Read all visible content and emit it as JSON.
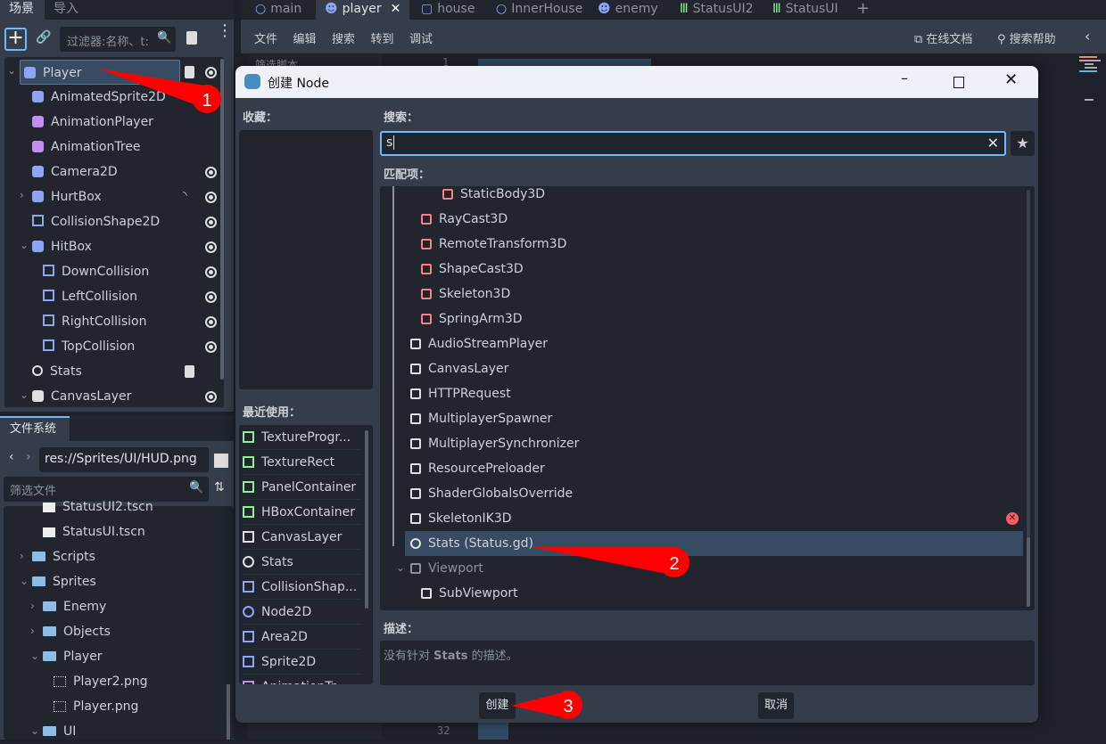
{
  "left_dock": {
    "tabs": [
      "场景",
      "导入"
    ],
    "filter_placeholder": "过滤器:名称、t:",
    "scene_tree": [
      {
        "label": "Player",
        "icon": "character-body-icon",
        "selected": true,
        "script": true,
        "visible": true
      },
      {
        "label": "AnimatedSprite2D",
        "icon": "animated-sprite-icon"
      },
      {
        "label": "AnimationPlayer",
        "icon": "animation-player-icon"
      },
      {
        "label": "AnimationTree",
        "icon": "animation-tree-icon"
      },
      {
        "label": "Camera2D",
        "icon": "camera-icon",
        "visible": true
      },
      {
        "label": "HurtBox",
        "icon": "area2d-icon",
        "signal": true,
        "visible": true
      },
      {
        "label": "CollisionShape2D",
        "icon": "collision-shape-icon",
        "visible": true
      },
      {
        "label": "HitBox",
        "icon": "area2d-icon",
        "visible": true
      },
      {
        "label": "DownCollision",
        "icon": "collision-shape-icon",
        "visible": true
      },
      {
        "label": "LeftCollision",
        "icon": "collision-shape-icon",
        "visible": true
      },
      {
        "label": "RightCollision",
        "icon": "collision-shape-icon",
        "visible": true
      },
      {
        "label": "TopCollision",
        "icon": "collision-shape-icon",
        "visible": true
      },
      {
        "label": "Stats",
        "icon": "node-icon",
        "script": true
      },
      {
        "label": "CanvasLayer",
        "icon": "canvas-layer-icon",
        "visible": true
      }
    ],
    "filesystem": {
      "tab": "文件系统",
      "path": "res://Sprites/UI/HUD.png",
      "filter_placeholder": "筛选文件",
      "items": [
        {
          "label": "StatusUI2.tscn",
          "type": "scene"
        },
        {
          "label": "StatusUI.tscn",
          "type": "scene"
        },
        {
          "label": "Scripts",
          "type": "folder"
        },
        {
          "label": "Sprites",
          "type": "folder"
        },
        {
          "label": "Enemy",
          "type": "folder"
        },
        {
          "label": "Objects",
          "type": "folder"
        },
        {
          "label": "Player",
          "type": "folder"
        },
        {
          "label": "Player2.png",
          "type": "image"
        },
        {
          "label": "Player.png",
          "type": "image"
        },
        {
          "label": "UI",
          "type": "folder"
        }
      ]
    }
  },
  "editor": {
    "tabs": [
      "main",
      "player",
      "house",
      "InnerHouse",
      "enemy",
      "StatusUI2",
      "StatusUI"
    ],
    "active_tab": "player",
    "menu": [
      "文件",
      "编辑",
      "搜索",
      "转到",
      "调试"
    ],
    "online_docs": "在线文档",
    "search_help": "搜索帮助",
    "script_filter": "筛选脚本",
    "line_numbers": [
      "1",
      "32"
    ]
  },
  "dialog": {
    "title": "创建 Node",
    "favorites_label": "收藏：",
    "recent_label": "最近使用：",
    "recent": [
      {
        "label": "TextureProgr...",
        "color": "#8eef97"
      },
      {
        "label": "TextureRect",
        "color": "#8eef97"
      },
      {
        "label": "PanelContainer",
        "color": "#8eef97"
      },
      {
        "label": "HBoxContainer",
        "color": "#8eef97"
      },
      {
        "label": "CanvasLayer",
        "color": "#e0e0e0"
      },
      {
        "label": "Stats",
        "color": "#e0e0e0"
      },
      {
        "label": "CollisionShap...",
        "color": "#8da5f3"
      },
      {
        "label": "Node2D",
        "color": "#8da5f3"
      },
      {
        "label": "Area2D",
        "color": "#8da5f3"
      },
      {
        "label": "Sprite2D",
        "color": "#8da5f3"
      },
      {
        "label": "AnimationTr...",
        "color": "#c38ef1"
      }
    ],
    "search_label": "搜索：",
    "search_value": "s",
    "matches_label": "匹配项：",
    "matches": [
      {
        "label": "StaticBody3D",
        "color": "#fc7f7f"
      },
      {
        "label": "RayCast3D",
        "color": "#fc7f7f"
      },
      {
        "label": "RemoteTransform3D",
        "color": "#fc7f7f"
      },
      {
        "label": "ShapeCast3D",
        "color": "#fc7f7f"
      },
      {
        "label": "Skeleton3D",
        "color": "#fc7f7f"
      },
      {
        "label": "SpringArm3D",
        "color": "#fc7f7f"
      },
      {
        "label": "AudioStreamPlayer",
        "color": "#e0e0e0"
      },
      {
        "label": "CanvasLayer",
        "color": "#e0e0e0"
      },
      {
        "label": "HTTPRequest",
        "color": "#e0e0e0"
      },
      {
        "label": "MultiplayerSpawner",
        "color": "#e0e0e0"
      },
      {
        "label": "MultiplayerSynchronizer",
        "color": "#e0e0e0"
      },
      {
        "label": "ResourcePreloader",
        "color": "#e0e0e0"
      },
      {
        "label": "ShaderGlobalsOverride",
        "color": "#e0e0e0"
      },
      {
        "label": "SkeletonIK3D",
        "color": "#e0e0e0",
        "deprecated": true
      },
      {
        "label": "Stats (Status.gd)",
        "color": "#e0e0e0",
        "selected": true
      },
      {
        "label": "Viewport",
        "color": "#8c919a",
        "disabled": true
      },
      {
        "label": "SubViewport",
        "color": "#e0e0e0"
      }
    ],
    "description_label": "描述：",
    "description_pre": "没有针对 ",
    "description_bold": "Stats",
    "description_post": " 的描述。",
    "create": "创建",
    "cancel": "取消"
  },
  "annotations": [
    "1",
    "2",
    "3"
  ],
  "colors": {
    "accent": "#70bafa",
    "selection": "#374b62",
    "callout": "#ff0000"
  }
}
